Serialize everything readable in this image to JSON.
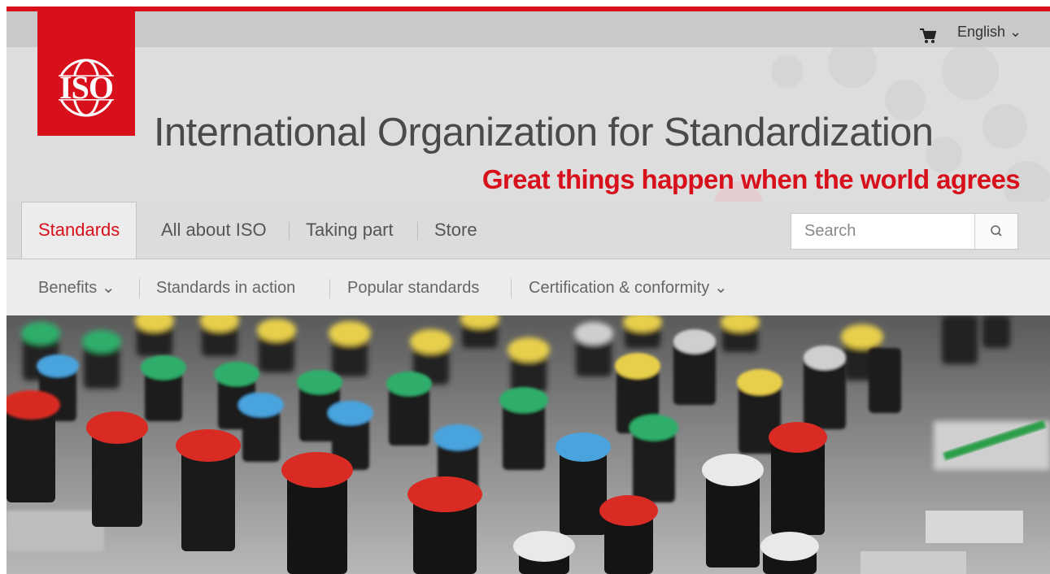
{
  "header": {
    "org_name": "International Organization for Standardization",
    "tagline": "Great things happen when the world agrees",
    "logo_text": "ISO",
    "brand_color": "#d8101b"
  },
  "utility": {
    "cart_icon": "shopping-cart-icon",
    "language": "English ⌄"
  },
  "main_nav": {
    "tabs": [
      {
        "label": "Standards",
        "active": true
      },
      {
        "label": "All about ISO",
        "active": false
      },
      {
        "label": "Taking part",
        "active": false
      },
      {
        "label": "Store",
        "active": false
      }
    ],
    "search": {
      "placeholder": "Search",
      "value": "",
      "icon": "search-icon"
    }
  },
  "sub_nav": {
    "items": [
      {
        "label": "Benefits ⌄"
      },
      {
        "label": "Standards in action"
      },
      {
        "label": "Popular standards"
      },
      {
        "label": "Certification & conformity ⌄"
      }
    ]
  },
  "hero": {
    "image": "audio-mixer-knobs",
    "knob_colors": [
      "#d92b24",
      "#4aa3dd",
      "#2fae6a",
      "#e8cf4c",
      "#e9e9e9"
    ]
  }
}
